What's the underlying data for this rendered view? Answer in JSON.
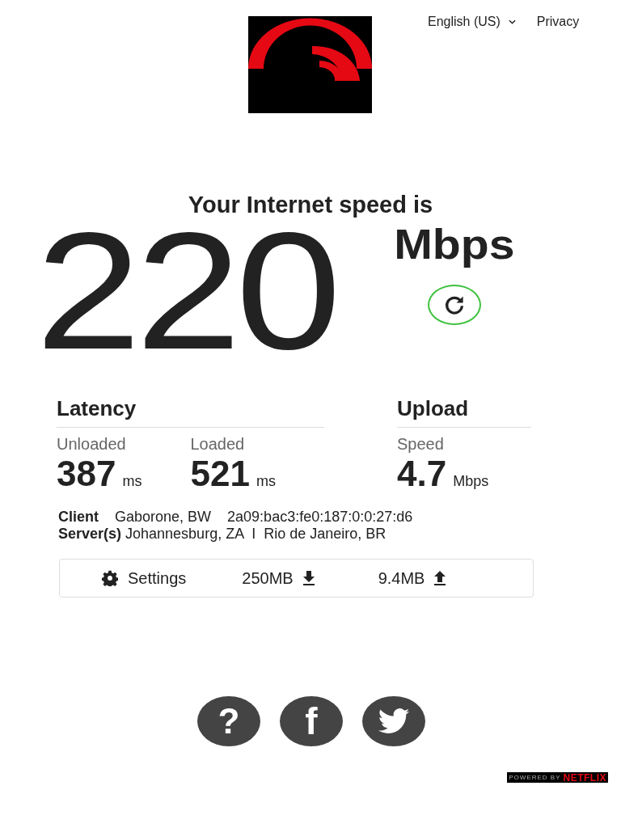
{
  "header": {
    "language": "English (US)",
    "privacy": "Privacy"
  },
  "headline": "Your Internet speed is",
  "speed": {
    "value": "220",
    "unit": "Mbps"
  },
  "latency": {
    "title": "Latency",
    "metrics": [
      {
        "label": "Unloaded",
        "value": "387",
        "unit": "ms"
      },
      {
        "label": "Loaded",
        "value": "521",
        "unit": "ms"
      }
    ]
  },
  "upload": {
    "title": "Upload",
    "metrics": [
      {
        "label": "Speed",
        "value": "4.7",
        "unit": "Mbps"
      }
    ]
  },
  "client": {
    "label": "Client",
    "location": "Gaborone, BW",
    "address": "2a09:bac3:fe0:187:0:0:27:d6"
  },
  "servers": {
    "label": "Server(s)",
    "locations": "Johannesburg, ZA  I  Rio de Janeiro, BR"
  },
  "settings_bar": {
    "settings": "Settings",
    "download_size": "250MB",
    "upload_size": "9.4MB"
  },
  "social": [
    {
      "kind": "help",
      "glyph": "?"
    },
    {
      "kind": "facebook",
      "glyph": "f"
    },
    {
      "kind": "twitter"
    }
  ],
  "footer": {
    "powered_by": "POWERED BY",
    "brand": "NETFLIX"
  }
}
